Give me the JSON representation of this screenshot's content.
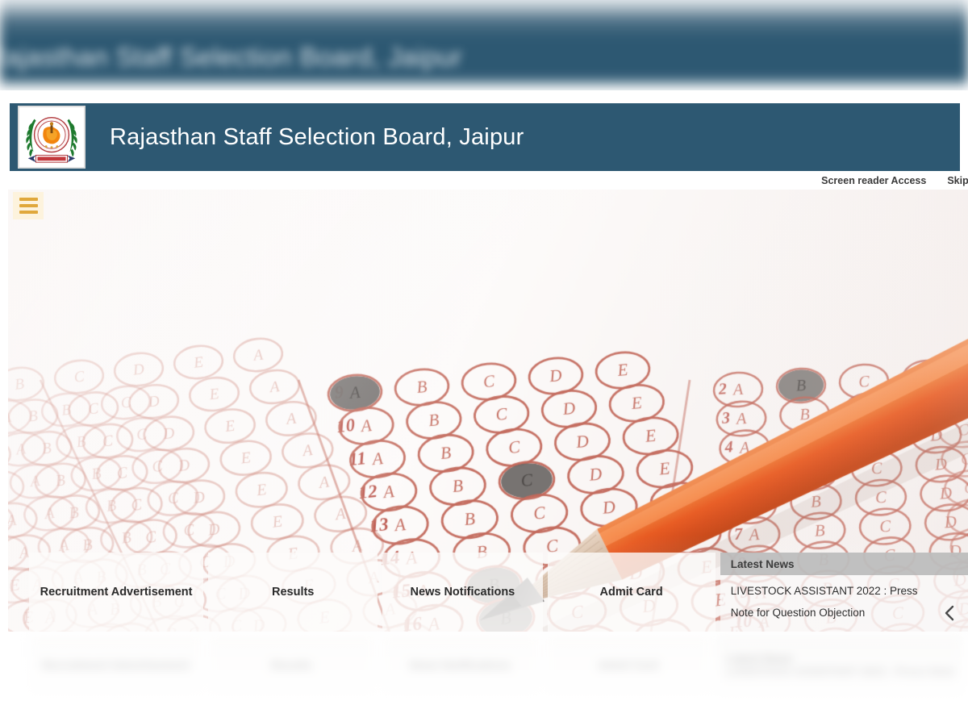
{
  "ghost_banner": {
    "text": "Rajasthan Staff Selection Board, Jaipur"
  },
  "header": {
    "title": "Rajasthan Staff Selection Board, Jaipur",
    "logo_alt": "rajasthan-state-emblem",
    "bar_color": "#2d5872"
  },
  "utility": {
    "screen_reader": "Screen reader Access",
    "skip_to": "Skip to"
  },
  "hero": {
    "menu_icon": "hamburger-icon",
    "menu_icon_bg": "#fdf3dd",
    "menu_icon_bar_color": "#e0a83c",
    "image_alt": "omr-answer-sheet-with-orange-pencil",
    "pencil_color": "#e8591f",
    "bubble_color": "#c46a5c"
  },
  "nav_cards": [
    {
      "label": "Recruitment Advertisement"
    },
    {
      "label": "Results"
    },
    {
      "label": "News Notifications"
    },
    {
      "label": "Admit Card"
    }
  ],
  "news": {
    "heading": "Latest News",
    "items": [
      "LIVESTOCK ASSISTANT 2022 : Press Note for Question Objection"
    ],
    "prev_icon": "chevron-left-icon",
    "header_bg": "#b0b0b0"
  },
  "ghost_footer": {
    "cards": [
      "Recruitment Advertisement",
      "Results",
      "News Notifications",
      "Admit Card"
    ],
    "news_heading": "Latest News",
    "news_text": "LIVESTOCK ASSISTANT 2022 : Press Note"
  }
}
